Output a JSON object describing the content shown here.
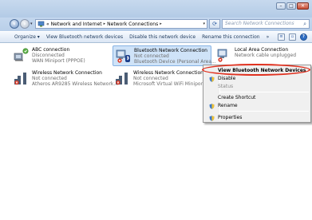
{
  "window": {
    "caption": {
      "minimize": "–",
      "maximize": "□",
      "close": "✕"
    }
  },
  "address_bar": {
    "breadcrumbs": [
      "«",
      "Network and Internet",
      "Network Connections"
    ],
    "search_placeholder": "Search Network Connections"
  },
  "command_bar": {
    "items": [
      "Organize ▾",
      "View Bluetooth network devices",
      "Disable this network device",
      "Rename this connection",
      "»"
    ]
  },
  "connections": [
    {
      "name": "ABC connection",
      "status": "Disconnected",
      "device": "WAN Miniport (PPPOE)",
      "icon": "dialup-connection-icon"
    },
    {
      "name": "Bluetooth Network Connection",
      "status": "Not connected",
      "device": "Bluetooth Device (Personal Area...",
      "icon": "bluetooth-adapter-icon"
    },
    {
      "name": "Local Area Connection",
      "status": "Network cable unplugged",
      "device": "",
      "icon": "ethernet-adapter-icon"
    },
    {
      "name": "Wireless Network Connection",
      "status": "Not connected",
      "device": "Atheros AR9285 Wireless Network...",
      "icon": "wireless-adapter-icon"
    },
    {
      "name": "Wireless Network Connection 2",
      "status": "Not connected",
      "device": "Microsoft Virtual WiFi Miniport A...",
      "icon": "wireless-adapter-icon"
    }
  ],
  "context_menu": {
    "items": [
      {
        "label": "View Bluetooth Network Devices",
        "bold": true,
        "enabled": true
      },
      {
        "label": "Disable",
        "enabled": true,
        "icon": "shield-icon"
      },
      {
        "label": "Status",
        "enabled": false
      },
      {
        "label": "Create Shortcut",
        "enabled": true
      },
      {
        "label": "Rename",
        "enabled": true,
        "icon": "shield-icon"
      },
      {
        "label": "Properties",
        "enabled": true,
        "icon": "shield-icon"
      }
    ]
  },
  "colors": {
    "highlight_ring": "#e0301e",
    "selection": "#cfe3f8"
  }
}
